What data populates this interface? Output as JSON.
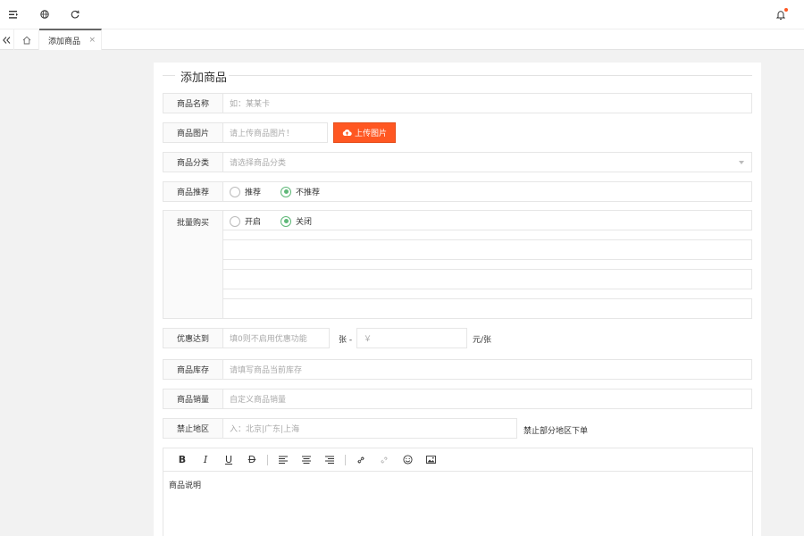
{
  "header": {
    "menu_icon": "menu-icon",
    "globe_icon": "globe-icon",
    "refresh_icon": "refresh-icon",
    "bell_icon": "bell-icon"
  },
  "tabs": {
    "back_icon": "double-chevron-left-icon",
    "home_icon": "home-icon",
    "active_tab_label": "添加商品",
    "close_glyph": "×"
  },
  "form": {
    "title": "添加商品",
    "name": {
      "label": "商品名称",
      "placeholder": "如：某某卡"
    },
    "image": {
      "label": "商品图片",
      "placeholder": "请上传商品图片！",
      "upload_label": "上传图片"
    },
    "category": {
      "label": "商品分类",
      "placeholder": "请选择商品分类"
    },
    "recommend": {
      "label": "商品推荐",
      "options": [
        "推荐",
        "不推荐"
      ],
      "selected": "不推荐"
    },
    "batch": {
      "label": "批量购买",
      "options": [
        "开启",
        "关闭"
      ],
      "selected": "关闭"
    },
    "discount": {
      "label": "优惠达到",
      "placeholder": "填0则不启用优惠功能",
      "mid": "张 -",
      "price_placeholder": "￥",
      "suffix": "元/张"
    },
    "stock": {
      "label": "商品库存",
      "placeholder": "请填写商品当前库存"
    },
    "sales": {
      "label": "商品销量",
      "placeholder": "自定义商品销量"
    },
    "region": {
      "label": "禁止地区",
      "placeholder": "入：北京|广东|上海",
      "suffix": "禁止部分地区下单"
    }
  },
  "editor": {
    "tools": [
      "B",
      "I",
      "U",
      "D"
    ],
    "content": "商品说明"
  },
  "colors": {
    "accent": "#ff5722",
    "radio_on": "#5fb878"
  }
}
